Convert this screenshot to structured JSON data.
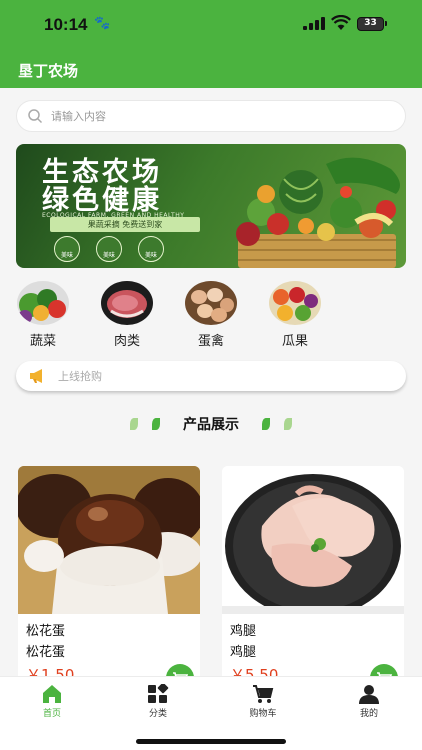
{
  "status_bar": {
    "time": "10:14",
    "battery": "33"
  },
  "header": {
    "title": "垦丁农场"
  },
  "search": {
    "placeholder": "请输入内容"
  },
  "banner": {
    "title_line1": "生态农场",
    "title_line2": "绿色健康",
    "subtitle_en": "ECOLOGICAL FARM, GREEN AND HEALTHY",
    "ribbon": "果蔬采摘 免费送到家",
    "tags": [
      "美味",
      "美味",
      "美味"
    ]
  },
  "categories": [
    {
      "label": "蔬菜",
      "icon": "vegetables-icon"
    },
    {
      "label": "肉类",
      "icon": "meat-icon"
    },
    {
      "label": "蛋禽",
      "icon": "eggs-icon"
    },
    {
      "label": "瓜果",
      "icon": "fruits-icon"
    }
  ],
  "promo": {
    "text": "上线抢购",
    "icon": "megaphone-icon"
  },
  "section": {
    "title": "产品展示"
  },
  "products": [
    {
      "name": "松花蛋",
      "subtitle": "松花蛋",
      "price": "￥1.50",
      "image": "century-egg"
    },
    {
      "name": "鸡腿",
      "subtitle": "鸡腿",
      "price": "￥5.50",
      "image": "chicken-leg"
    }
  ],
  "tabbar": {
    "items": [
      {
        "label": "首页",
        "icon": "home-icon",
        "active": true
      },
      {
        "label": "分类",
        "icon": "category-icon",
        "active": false
      },
      {
        "label": "购物车",
        "icon": "cart-icon",
        "active": false
      },
      {
        "label": "我的",
        "icon": "profile-icon",
        "active": false
      }
    ]
  },
  "colors": {
    "brand": "#4bb33f",
    "price": "#e0401f",
    "background": "#f5f5f5"
  }
}
